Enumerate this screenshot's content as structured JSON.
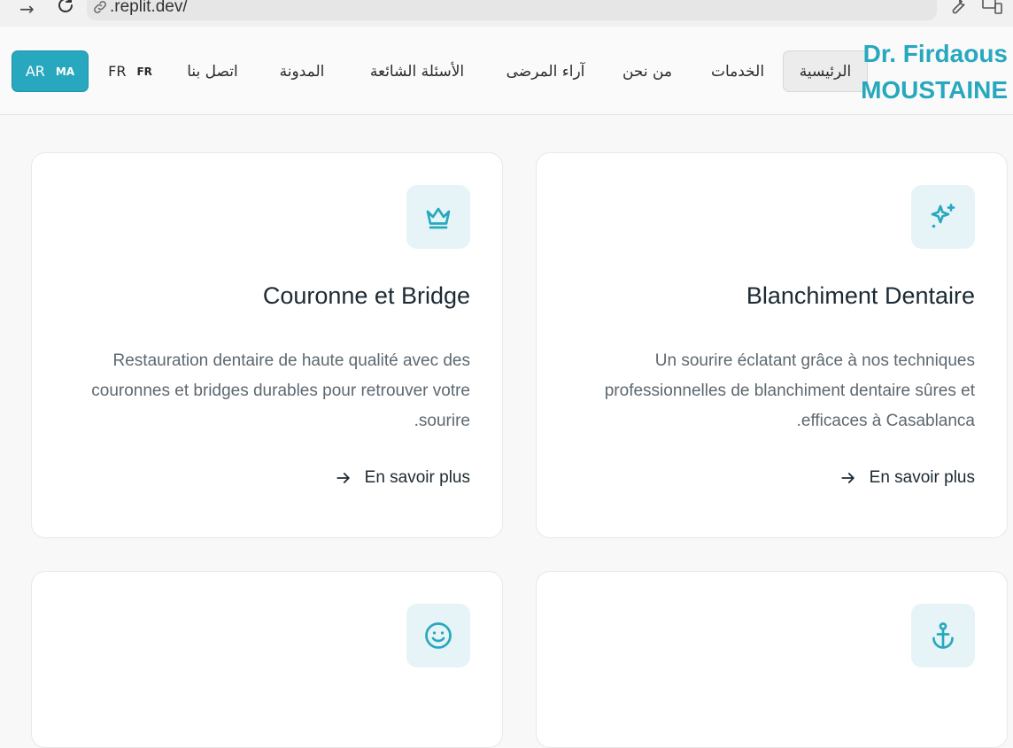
{
  "browser": {
    "url": ".replit.dev/"
  },
  "header": {
    "brand_line1": "Dr. Firdaous",
    "brand_line2": "MOUSTAINE",
    "nav": {
      "home": "الرئيسية",
      "services": "الخدمات",
      "about": "من نحن",
      "reviews": "آراء المرضى",
      "faq": "الأسئلة الشائعة",
      "blog": "المدونة",
      "contact": "اتصل بنا"
    },
    "languages": {
      "ar_code": "AR",
      "ar_region": "MA",
      "fr_code": "FR",
      "fr_region": "FR"
    }
  },
  "cards": {
    "whitening": {
      "icon": "sparkles-icon",
      "title": "Blanchiment Dentaire",
      "description": "Un sourire éclatant grâce à nos techniques professionnelles de blanchiment dentaire sûres et efficaces à Casablanca.",
      "link": "En savoir plus"
    },
    "crown": {
      "icon": "crown-icon",
      "title": "Couronne et Bridge",
      "description": "Restauration dentaire de haute qualité avec des couronnes et bridges durables pour retrouver votre sourire.",
      "link": "En savoir plus"
    },
    "implant": {
      "icon": "anchor-icon"
    },
    "smile": {
      "icon": "smile-icon"
    }
  },
  "colors": {
    "accent": "#28a8be",
    "icon_bg": "#e6f4f7",
    "page_bg": "#f8f8f8"
  }
}
